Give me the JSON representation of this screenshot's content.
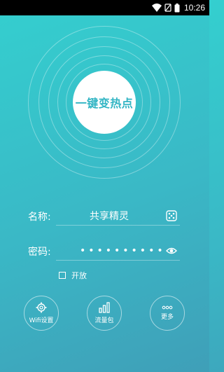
{
  "status_bar": {
    "time": "10:26"
  },
  "hotspot": {
    "label": "一键变热点"
  },
  "form": {
    "name_label": "名称:",
    "name_value": "共享精灵",
    "password_label": "密码:",
    "password_mask": "••••••••••",
    "open_label": "开放"
  },
  "bottom": {
    "wifi_settings": "Wifi设置",
    "data_package": "流量包",
    "more": "更多"
  },
  "icons": {
    "name_field": "dice-icon",
    "password_field": "eye-icon",
    "wifi_settings": "gear-icon",
    "data_package": "bar-chart-icon",
    "more": "ellipsis-icon"
  },
  "colors": {
    "accent": "#32b5c4"
  }
}
